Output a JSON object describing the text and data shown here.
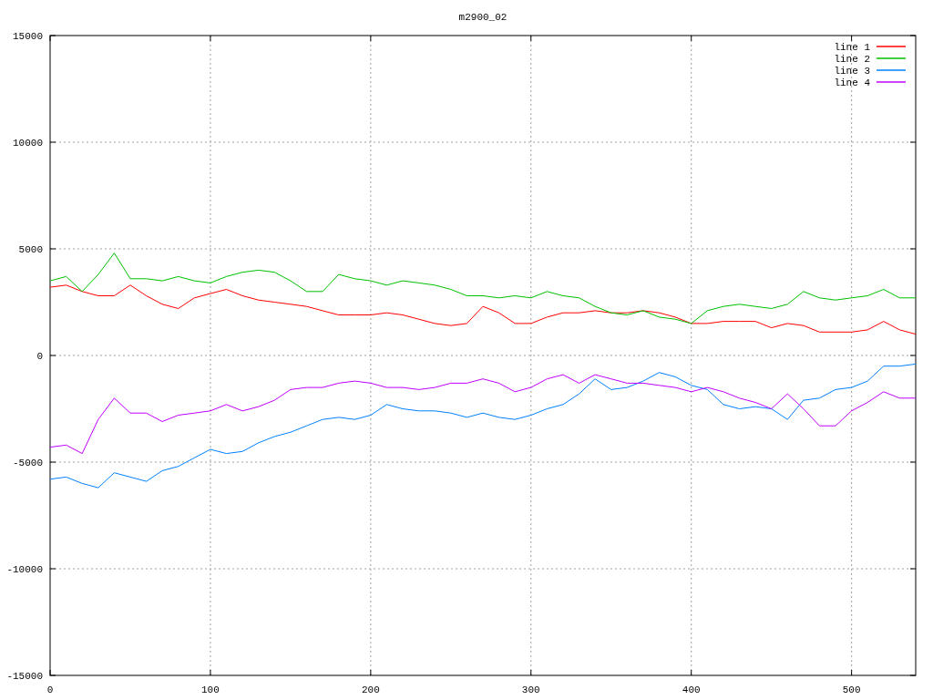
{
  "chart_data": {
    "type": "line",
    "title": "m2900_02",
    "x": [
      0,
      10,
      20,
      30,
      40,
      50,
      60,
      70,
      80,
      90,
      100,
      110,
      120,
      130,
      140,
      150,
      160,
      170,
      180,
      190,
      200,
      210,
      220,
      230,
      240,
      250,
      260,
      270,
      280,
      290,
      300,
      310,
      320,
      330,
      340,
      350,
      360,
      370,
      380,
      390,
      400,
      410,
      420,
      430,
      440,
      450,
      460,
      470,
      480,
      490,
      500,
      510,
      520,
      530,
      540
    ],
    "xlim": [
      0,
      540
    ],
    "ylim": [
      -15000,
      15000
    ],
    "xticks": [
      0,
      100,
      200,
      300,
      400,
      500
    ],
    "yticks": [
      -15000,
      -10000,
      -5000,
      0,
      5000,
      10000,
      15000
    ],
    "grid": true,
    "legend": true,
    "series": [
      {
        "name": "line 1",
        "color": "#ff0000",
        "values": [
          3200,
          3300,
          3000,
          2800,
          2800,
          3300,
          2800,
          2400,
          2200,
          2700,
          2900,
          3100,
          2800,
          2600,
          2500,
          2400,
          2300,
          2100,
          1900,
          1900,
          1900,
          2000,
          1900,
          1700,
          1500,
          1400,
          1500,
          2300,
          2000,
          1500,
          1500,
          1800,
          2000,
          2000,
          2100,
          2000,
          2000,
          2100,
          2000,
          1800,
          1500,
          1500,
          1600,
          1600,
          1600,
          1300,
          1500,
          1400,
          1100,
          1100,
          1100,
          1200,
          1600,
          1200,
          1000
        ]
      },
      {
        "name": "line 2",
        "color": "#00c000",
        "values": [
          3500,
          3700,
          3000,
          3800,
          4800,
          3600,
          3600,
          3500,
          3700,
          3500,
          3400,
          3700,
          3900,
          4000,
          3900,
          3500,
          3000,
          3000,
          3800,
          3600,
          3500,
          3300,
          3500,
          3400,
          3300,
          3100,
          2800,
          2800,
          2700,
          2800,
          2700,
          3000,
          2800,
          2700,
          2300,
          2000,
          1900,
          2100,
          1800,
          1700,
          1500,
          2100,
          2300,
          2400,
          2300,
          2200,
          2400,
          3000,
          2700,
          2600,
          2700,
          2800,
          3100,
          2700,
          2700
        ]
      },
      {
        "name": "line 3",
        "color": "#0080ff",
        "values": [
          -5800,
          -5700,
          -6000,
          -6200,
          -5500,
          -5700,
          -5900,
          -5400,
          -5200,
          -4800,
          -4400,
          -4600,
          -4500,
          -4100,
          -3800,
          -3600,
          -3300,
          -3000,
          -2900,
          -3000,
          -2800,
          -2300,
          -2500,
          -2600,
          -2600,
          -2700,
          -2900,
          -2700,
          -2900,
          -3000,
          -2800,
          -2500,
          -2300,
          -1800,
          -1100,
          -1600,
          -1500,
          -1200,
          -800,
          -1000,
          -1400,
          -1600,
          -2300,
          -2500,
          -2400,
          -2500,
          -3000,
          -2100,
          -2000,
          -1600,
          -1500,
          -1200,
          -500,
          -500,
          -400
        ]
      },
      {
        "name": "line 4",
        "color": "#c000ff",
        "values": [
          -4300,
          -4200,
          -4600,
          -3000,
          -2000,
          -2700,
          -2700,
          -3100,
          -2800,
          -2700,
          -2600,
          -2300,
          -2600,
          -2400,
          -2100,
          -1600,
          -1500,
          -1500,
          -1300,
          -1200,
          -1300,
          -1500,
          -1500,
          -1600,
          -1500,
          -1300,
          -1300,
          -1100,
          -1300,
          -1700,
          -1500,
          -1100,
          -900,
          -1300,
          -900,
          -1100,
          -1300,
          -1300,
          -1400,
          -1500,
          -1700,
          -1500,
          -1700,
          -2000,
          -2200,
          -2500,
          -1800,
          -2500,
          -3300,
          -3300,
          -2600,
          -2200,
          -1700,
          -2000,
          -2000
        ]
      }
    ]
  }
}
